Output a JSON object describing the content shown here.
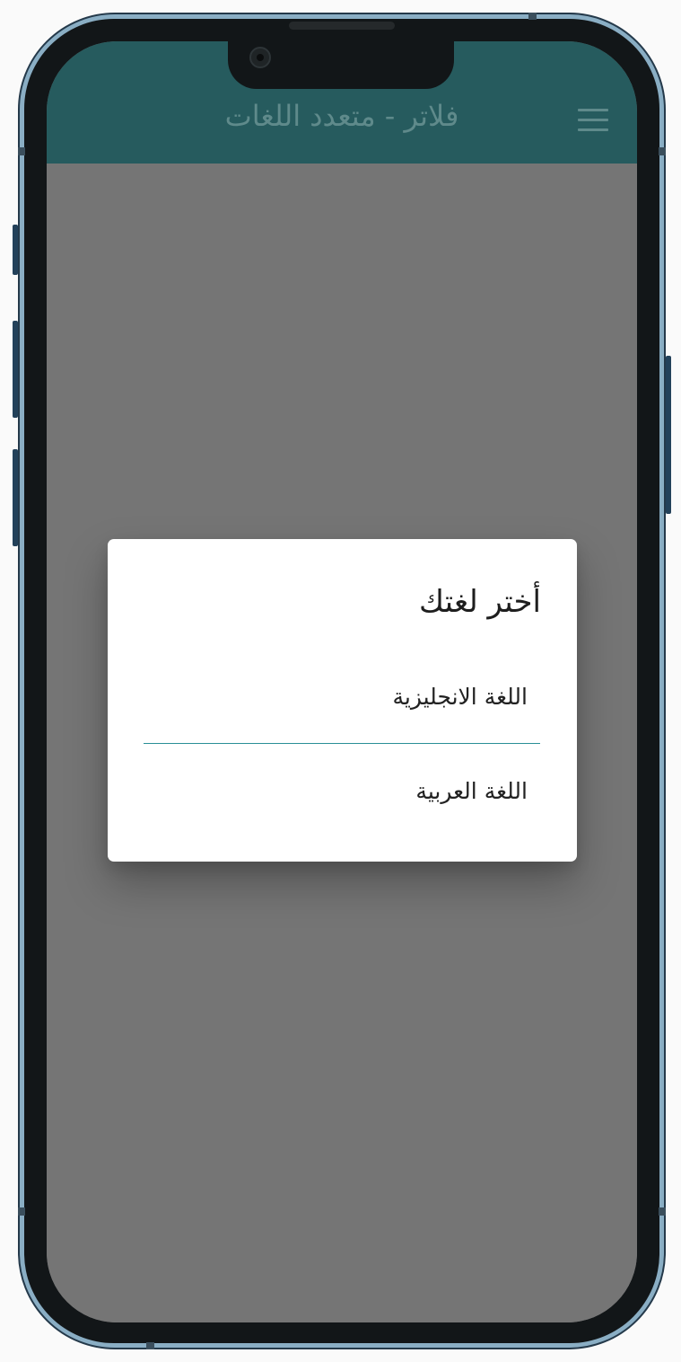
{
  "app_bar": {
    "title": "فلاتر - متعدد اللغات",
    "menu_icon": "menu-icon"
  },
  "dialog": {
    "title": "أختر لغتك",
    "options": [
      {
        "label": "اللغة الانجليزية"
      },
      {
        "label": "اللغة العربية"
      }
    ]
  },
  "colors": {
    "app_bar": "#265b5e",
    "title_text": "#5f8a8b",
    "scrim": "#757575",
    "divider": "#2a8f96",
    "frame": "#8aaec4"
  }
}
